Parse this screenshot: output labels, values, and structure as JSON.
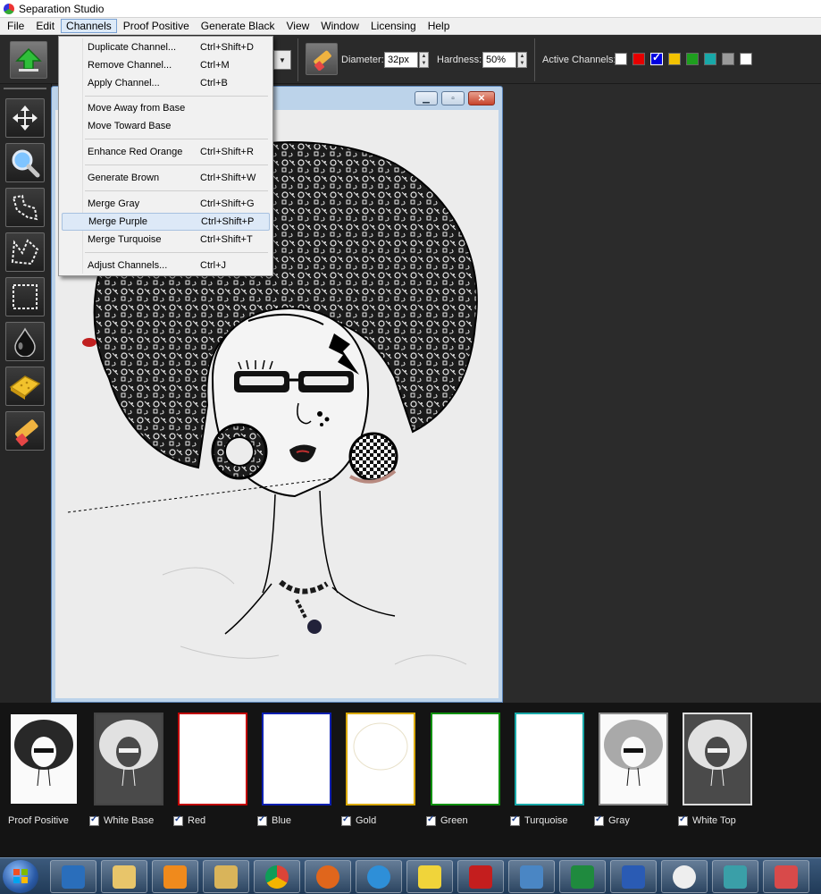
{
  "window": {
    "title": "Separation Studio"
  },
  "menubar": {
    "items": [
      "File",
      "Edit",
      "Channels",
      "Proof Positive",
      "Generate Black",
      "View",
      "Window",
      "Licensing",
      "Help"
    ]
  },
  "toolbar": {
    "diameter_label": "Diameter:",
    "diameter_value": "32px",
    "hardness_label": "Hardness:",
    "hardness_value": "50%",
    "active_channels_label": "Active Channels:",
    "active_channel_colors": [
      "#ffffff",
      "#e60000",
      "#0000e0",
      "#f2c200",
      "#1e9e1e",
      "#18a8a8",
      "#9a9a9a",
      "#ffffff"
    ]
  },
  "channels_menu": {
    "items": [
      {
        "label": "Duplicate Channel...",
        "shortcut": "Ctrl+Shift+D"
      },
      {
        "label": "Remove Channel...",
        "shortcut": "Ctrl+M"
      },
      {
        "label": "Apply Channel...",
        "shortcut": "Ctrl+B"
      },
      {
        "label": "Move Away from Base",
        "shortcut": ""
      },
      {
        "label": "Move Toward Base",
        "shortcut": ""
      },
      {
        "label": "Enhance Red Orange",
        "shortcut": "Ctrl+Shift+R"
      },
      {
        "label": "Generate Brown",
        "shortcut": "Ctrl+Shift+W"
      },
      {
        "label": "Merge Gray",
        "shortcut": "Ctrl+Shift+G"
      },
      {
        "label": "Merge Purple",
        "shortcut": "Ctrl+Shift+P"
      },
      {
        "label": "Merge Turquoise",
        "shortcut": "Ctrl+Shift+T"
      },
      {
        "label": "Adjust Channels...",
        "shortcut": "Ctrl+J"
      }
    ],
    "highlighted": "Merge Purple"
  },
  "channels_strip": {
    "channels": [
      {
        "label": "Proof Positive",
        "checked": false,
        "border": "#141414"
      },
      {
        "label": "White Base",
        "checked": true,
        "border": "#444444"
      },
      {
        "label": "Red",
        "checked": true,
        "border": "#c00000"
      },
      {
        "label": "Blue",
        "checked": true,
        "border": "#0a1fb0"
      },
      {
        "label": "Gold",
        "checked": true,
        "border": "#d9a800"
      },
      {
        "label": "Green",
        "checked": true,
        "border": "#109010"
      },
      {
        "label": "Turquoise",
        "checked": true,
        "border": "#18a8a8"
      },
      {
        "label": "Gray",
        "checked": true,
        "border": "#8a8a8a"
      },
      {
        "label": "White Top",
        "checked": true,
        "border": "#dddddd"
      }
    ]
  },
  "tools": [
    "move-tool",
    "zoom-tool",
    "lasso-tool",
    "polygon-lasso-tool",
    "rectangle-select-tool",
    "ink-drop-tool",
    "sponge-tool",
    "eraser-tool"
  ],
  "taskbar": {
    "apps": [
      "outlook",
      "file-explorer",
      "media-player",
      "folder",
      "chrome",
      "firefox",
      "internet-explorer",
      "app-yellow",
      "acrobat",
      "photo-viewer",
      "excel",
      "word",
      "crosshair-app",
      "quill-app",
      "color-app"
    ]
  }
}
